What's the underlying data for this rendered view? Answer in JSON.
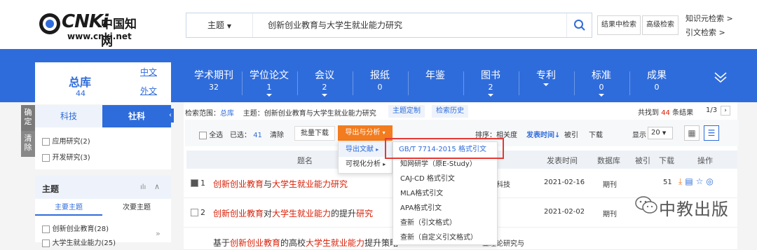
{
  "header": {
    "brand_mark": "CNKi",
    "brand_cn": "中国知网",
    "brand_url": "www.cnki.net",
    "search_field": "主题",
    "search_query": "创新创业教育与大学生就业能力研究",
    "btn_in_results": "结果中检索",
    "btn_advanced": "高级检索",
    "link_knowledge": "知识元检索 >",
    "link_citation": "引文检索 >"
  },
  "nav": {
    "zongku_label": "总库",
    "zongku_count": "44",
    "lang_cn": "中文",
    "lang_en": "外文",
    "items": [
      {
        "label": "学术期刊",
        "count": "32",
        "arrow": false
      },
      {
        "label": "学位论文",
        "count": "1",
        "arrow": true
      },
      {
        "label": "会议",
        "count": "2",
        "arrow": true
      },
      {
        "label": "报纸",
        "count": "0",
        "arrow": false
      },
      {
        "label": "年鉴",
        "count": "",
        "arrow": false
      },
      {
        "label": "图书",
        "count": "2",
        "arrow": true
      },
      {
        "label": "专利",
        "count": "",
        "arrow": true
      },
      {
        "label": "标准",
        "count": "0",
        "arrow": true
      },
      {
        "label": "成果",
        "count": "0",
        "arrow": false
      }
    ]
  },
  "sidebar": {
    "side_confirm": "确定",
    "side_clear": "清除",
    "tab_keji": "科技",
    "tab_sheke": "社科",
    "options": [
      "应用研究(2)",
      "开发研究(3)"
    ],
    "facet_title": "主题",
    "facet_tab_main": "主要主题",
    "facet_tab_sub": "次要主题",
    "facet_items": [
      "创新创业教育(28)",
      "大学生就业能力(25)"
    ]
  },
  "toolbar": {
    "scope_label": "检索范围：",
    "scope_value": "总库",
    "scope_topic": "主题：创新创业教育与大学生就业能力研究",
    "topic_custom": "主题定制",
    "history": "检索历史",
    "result_prefix": "共找到",
    "result_count": "44",
    "result_suffix": "条结果",
    "page_info": "1/3",
    "select_all": "全选",
    "selected_label": "已选：",
    "selected_count": "41",
    "clear": "清除",
    "batch_download": "批量下载",
    "export_analysis": "导出与分析",
    "sort_label": "排序：相关度",
    "sort_date": "发表时间",
    "sort_cite": "被引",
    "sort_download": "下载",
    "display_label": "显示",
    "display_count": "20"
  },
  "export_menu": {
    "export_refs": "导出文献",
    "visual_analysis": "可视化分析",
    "submenu": [
      "GB/T 7714-2015 格式引文",
      "知网研学（原E-Study）",
      "CAJ-CD 格式引文",
      "MLA格式引文",
      "APA格式引文",
      "查新（引文格式）",
      "查新（自定义引文格式）"
    ]
  },
  "table": {
    "headers": [
      "题名",
      "来源",
      "发表时间",
      "数据库",
      "被引",
      "下载",
      "操作"
    ],
    "rows": [
      {
        "num": "1",
        "title_parts": [
          {
            "t": "创新创业教育",
            "hl": true
          },
          {
            "t": "与",
            "hl": false
          },
          {
            "t": "大学生就业能力研究",
            "hl": true
          }
        ],
        "source": "济与科技",
        "date": "2021-02-16",
        "db": "期刊",
        "cite": "",
        "download": "51",
        "checked": true
      },
      {
        "num": "2",
        "title_parts": [
          {
            "t": "创新创业教育",
            "hl": true
          },
          {
            "t": "对",
            "hl": false
          },
          {
            "t": "大学生就业能力",
            "hl": true
          },
          {
            "t": "的提升",
            "hl": false
          },
          {
            "t": "研究",
            "hl": true
          }
        ],
        "source": "论",
        "date": "2021-02-02",
        "db": "期刊",
        "cite": "",
        "download": "",
        "checked": false
      },
      {
        "num": "",
        "title_parts": [
          {
            "t": "基于",
            "hl": false
          },
          {
            "t": "创新创业教育",
            "hl": true
          },
          {
            "t": "的高校",
            "hl": false
          },
          {
            "t": "大学生就业能力",
            "hl": true
          },
          {
            "t": "提升策略",
            "hl": false
          }
        ],
        "source": "业理论研究与",
        "date": "",
        "db": "",
        "cite": "",
        "download": "",
        "checked": false
      }
    ]
  },
  "watermark": "中教出版",
  "colors": {
    "brand_blue": "#2f6cdb",
    "orange": "#f27c1e",
    "red_highlight": "#d81e06"
  }
}
